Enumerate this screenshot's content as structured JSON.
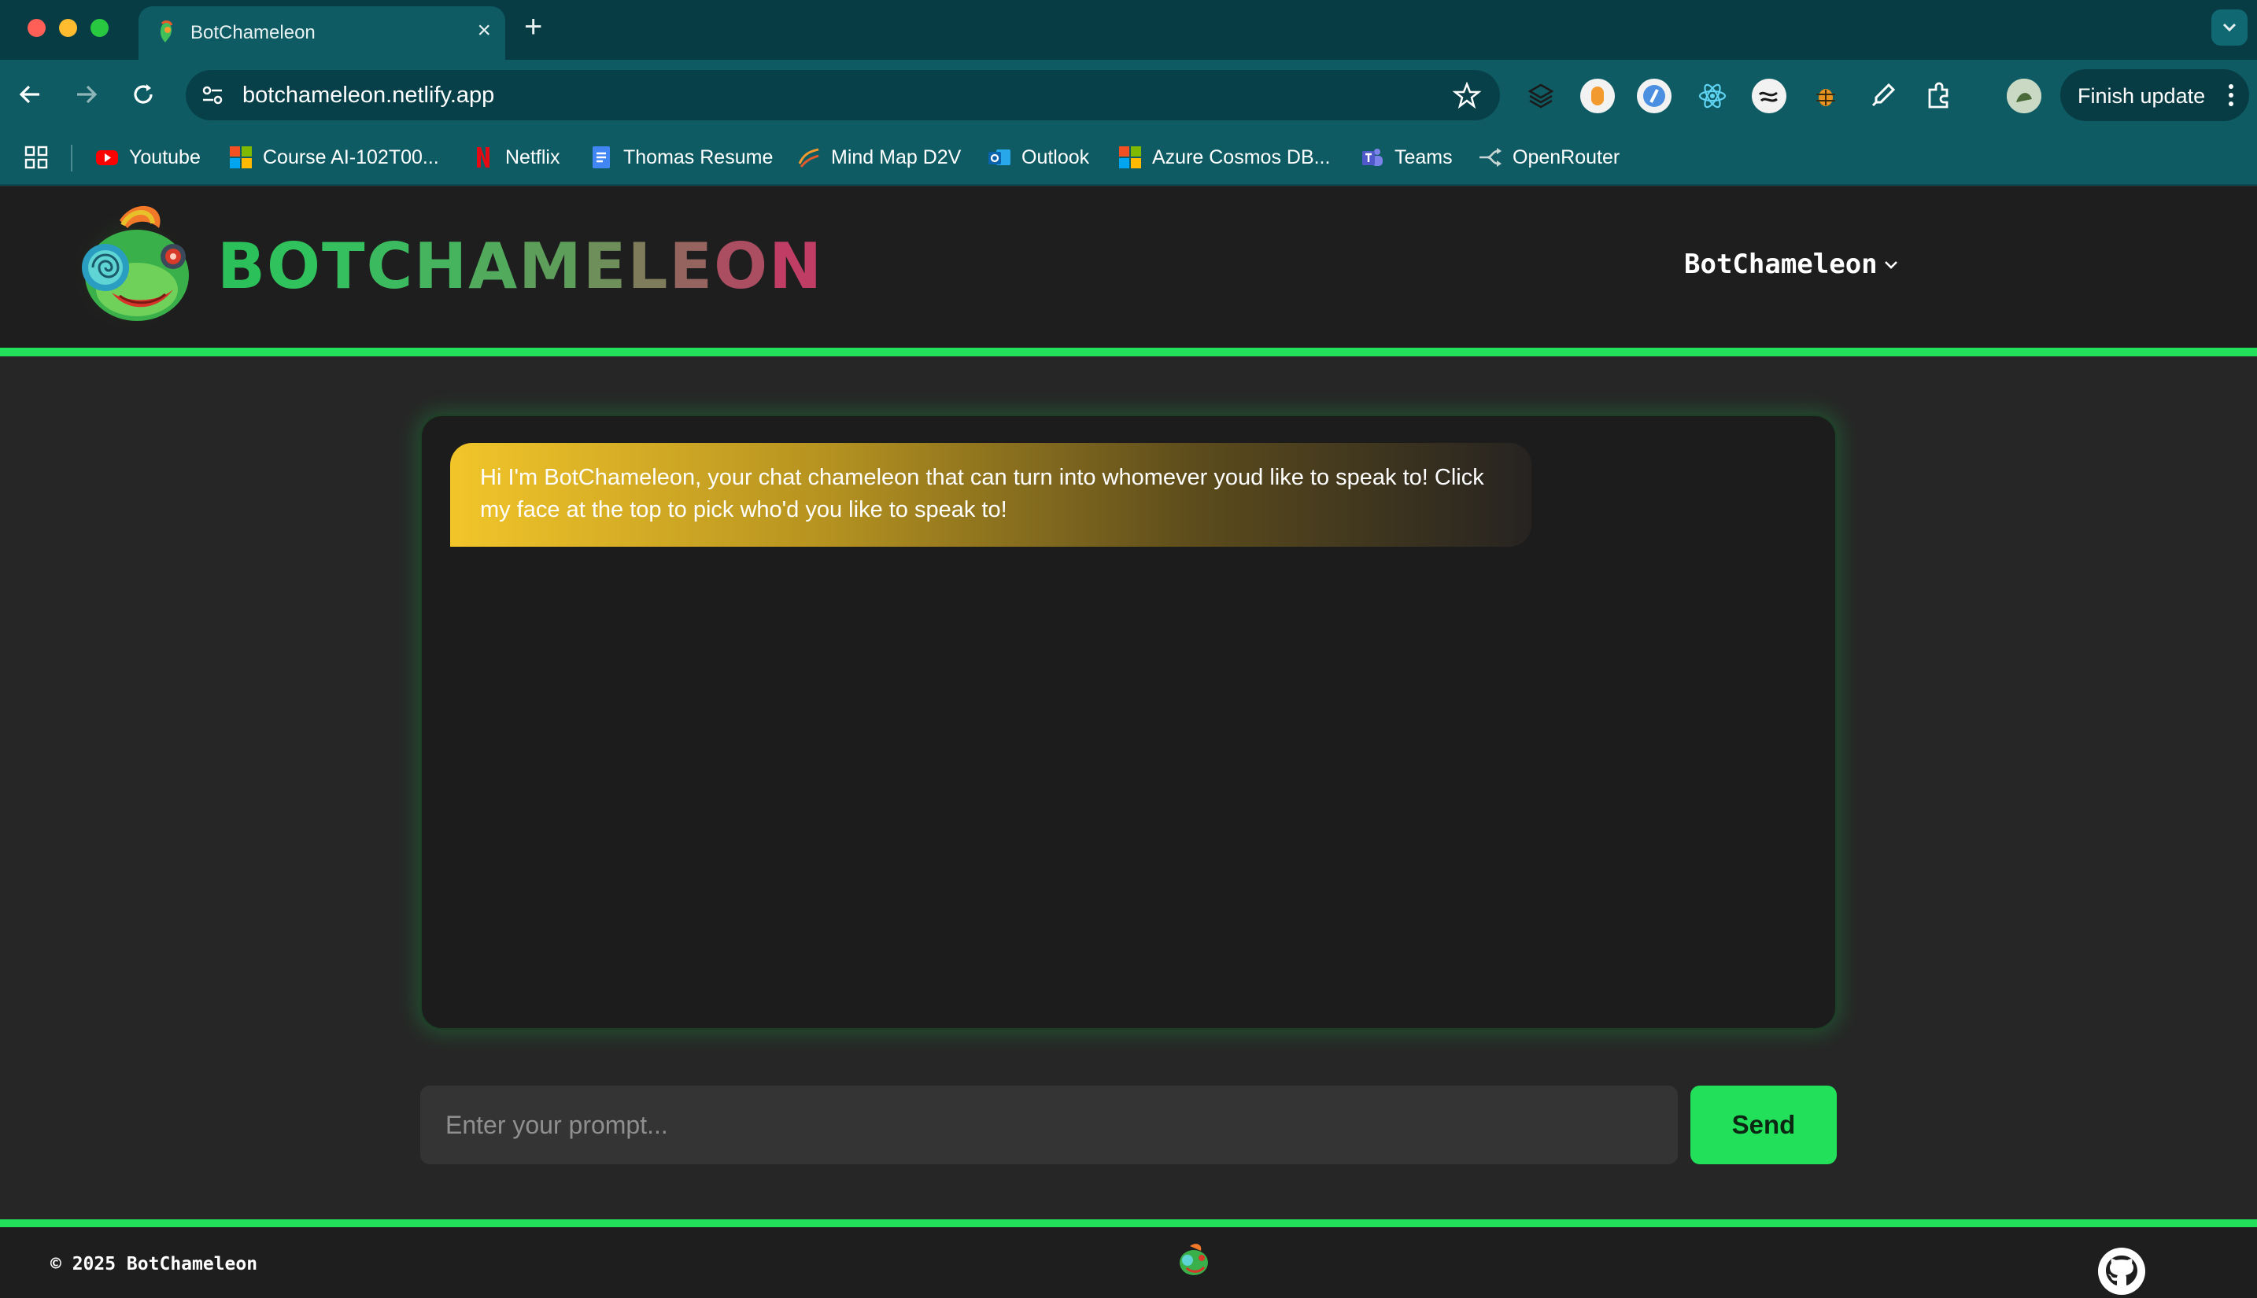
{
  "browser": {
    "tab_title": "BotChameleon",
    "tab_close": "×",
    "new_tab": "+",
    "url": "botchameleon.netlify.app",
    "finish_update": "Finish update",
    "bookmarks": [
      {
        "label": "Youtube",
        "icon": "youtube-icon"
      },
      {
        "label": "Course AI-102T00...",
        "icon": "microsoft-icon"
      },
      {
        "label": "Netflix",
        "icon": "netflix-icon"
      },
      {
        "label": "Thomas Resume",
        "icon": "docs-icon"
      },
      {
        "label": "Mind Map D2V",
        "icon": "mindmap-icon"
      },
      {
        "label": "Outlook",
        "icon": "outlook-icon"
      },
      {
        "label": "Azure Cosmos DB...",
        "icon": "microsoft-icon"
      },
      {
        "label": "Teams",
        "icon": "teams-icon"
      },
      {
        "label": "OpenRouter",
        "icon": "openrouter-icon"
      }
    ]
  },
  "header": {
    "logo_letters": [
      "B",
      "O",
      "T",
      "C",
      "H",
      "A",
      "M",
      "E",
      "L",
      "E",
      "O",
      "N"
    ],
    "persona_label": "BotChameleon"
  },
  "chat": {
    "messages": [
      {
        "role": "bot",
        "text": "Hi I'm BotChameleon, your chat chameleon that can turn into whomever youd like to speak to! Click my face at the top to pick who'd you like to speak to!"
      }
    ]
  },
  "input": {
    "placeholder": "Enter your prompt...",
    "send_label": "Send"
  },
  "footer": {
    "copyright": "© 2025 BotChameleon"
  },
  "colors": {
    "accent_green": "#22e05a",
    "chrome_teal": "#0e5b63",
    "bubble_gold": "#f2c52a"
  }
}
